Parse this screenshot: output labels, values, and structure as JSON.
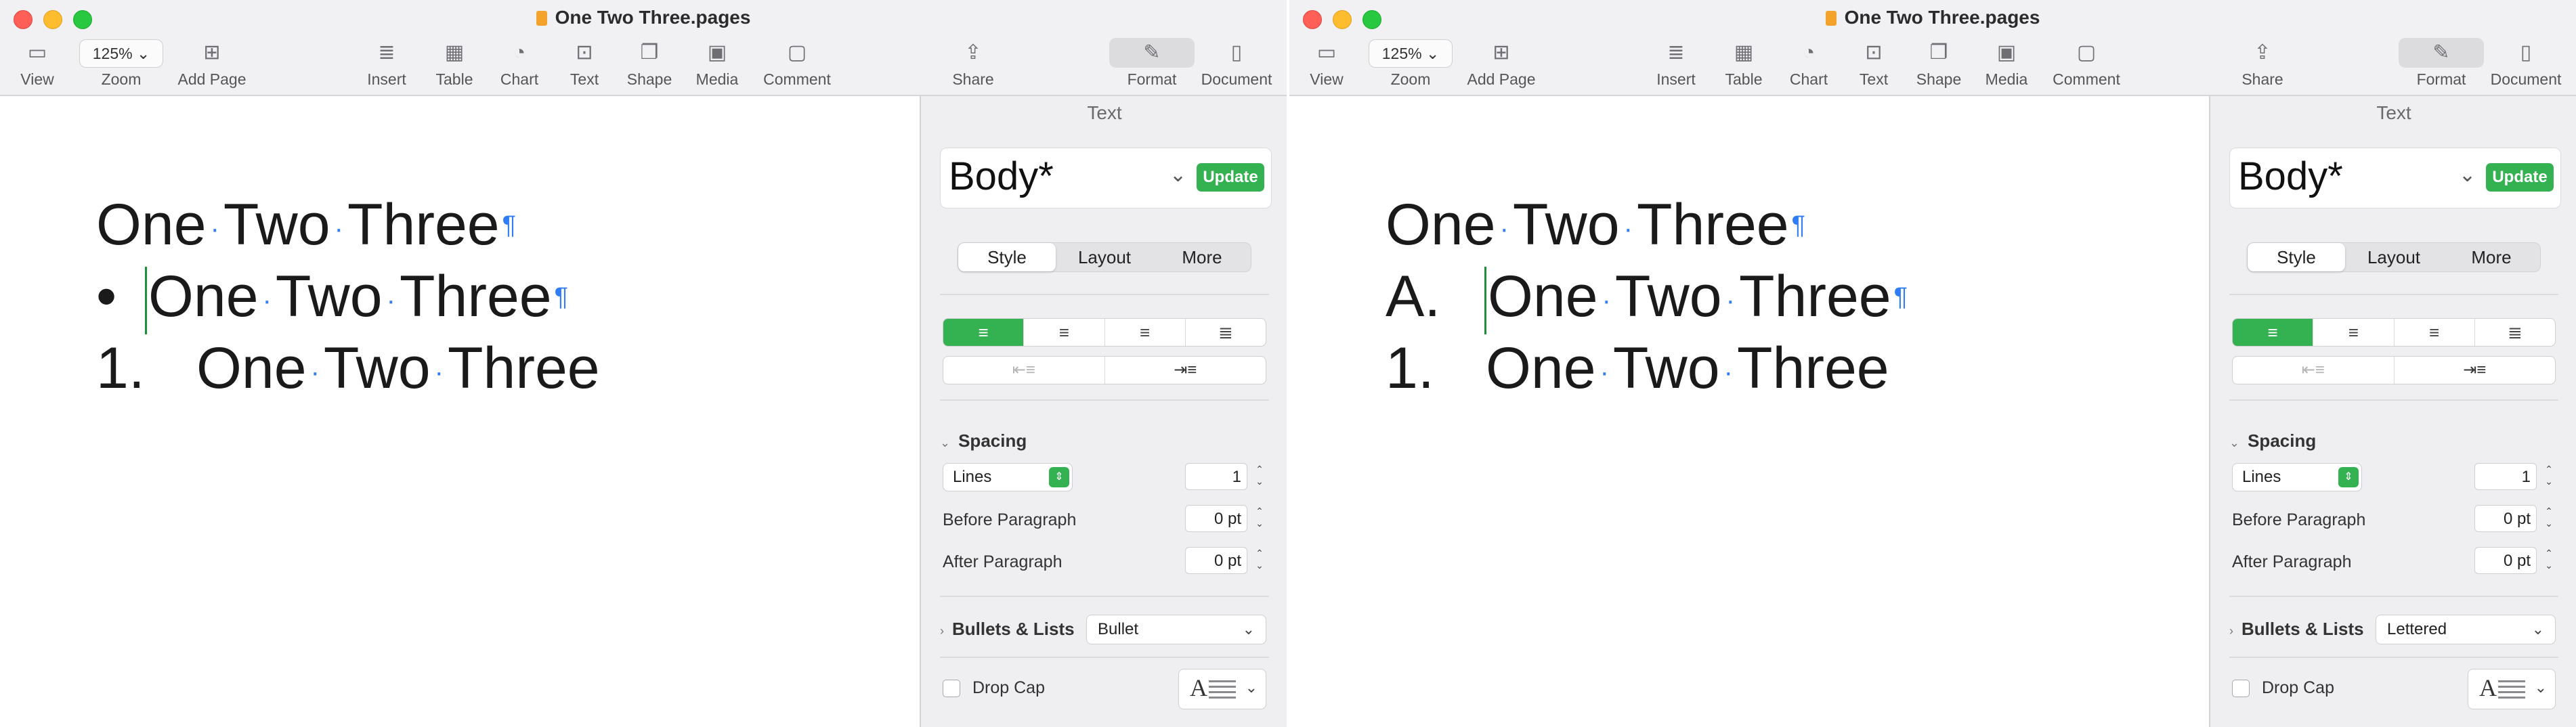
{
  "windows": [
    {
      "title": "One Two Three.pages",
      "toolbar": {
        "view": "View",
        "zoom_label": "Zoom",
        "zoom_value": "125%",
        "add_page": "Add Page",
        "insert": "Insert",
        "table": "Table",
        "chart": "Chart",
        "text": "Text",
        "shape": "Shape",
        "media": "Media",
        "comment": "Comment",
        "share": "Share",
        "format": "Format",
        "document": "Document"
      },
      "document": {
        "line1": {
          "w1": "One",
          "w2": "Two",
          "w3": "Three"
        },
        "line2": {
          "marker": "•",
          "w1": "One",
          "w2": "Two",
          "w3": "Three"
        },
        "line3": {
          "marker": "1.",
          "w1": "One",
          "w2": "Two",
          "w3": "Three"
        },
        "space_mark": "·",
        "pilcrow": "¶"
      },
      "inspector": {
        "header": "Text",
        "style_name": "Body*",
        "update_label": "Update",
        "tabs": [
          "Style",
          "Layout",
          "More"
        ],
        "spacing_label": "Spacing",
        "lines_label": "Lines",
        "lines_value": "1",
        "before_paragraph_label": "Before Paragraph",
        "before_paragraph_value": "0 pt",
        "after_paragraph_label": "After Paragraph",
        "after_paragraph_value": "0 pt",
        "bullets_label": "Bullets & Lists",
        "bullets_value": "Bullet",
        "drop_cap_label": "Drop Cap",
        "drop_cap_glyph": "A"
      }
    },
    {
      "title": "One Two Three.pages",
      "toolbar": {
        "view": "View",
        "zoom_label": "Zoom",
        "zoom_value": "125%",
        "add_page": "Add Page",
        "insert": "Insert",
        "table": "Table",
        "chart": "Chart",
        "text": "Text",
        "shape": "Shape",
        "media": "Media",
        "comment": "Comment",
        "share": "Share",
        "format": "Format",
        "document": "Document"
      },
      "document": {
        "line1": {
          "w1": "One",
          "w2": "Two",
          "w3": "Three"
        },
        "line2": {
          "marker": "A.",
          "w1": "One",
          "w2": "Two",
          "w3": "Three"
        },
        "line3": {
          "marker": "1.",
          "w1": "One",
          "w2": "Two",
          "w3": "Three"
        },
        "space_mark": "·",
        "pilcrow": "¶"
      },
      "inspector": {
        "header": "Text",
        "style_name": "Body*",
        "update_label": "Update",
        "tabs": [
          "Style",
          "Layout",
          "More"
        ],
        "spacing_label": "Spacing",
        "lines_label": "Lines",
        "lines_value": "1",
        "before_paragraph_label": "Before Paragraph",
        "before_paragraph_value": "0 pt",
        "after_paragraph_label": "After Paragraph",
        "after_paragraph_value": "0 pt",
        "bullets_label": "Bullets & Lists",
        "bullets_value": "Lettered",
        "drop_cap_label": "Drop Cap",
        "drop_cap_glyph": "A"
      }
    }
  ],
  "colors": {
    "accent_green": "#34b251",
    "invisibles_blue": "#2f7cf6",
    "close": "#ff5f57",
    "minimize": "#febc2e",
    "zoom": "#28c840"
  }
}
